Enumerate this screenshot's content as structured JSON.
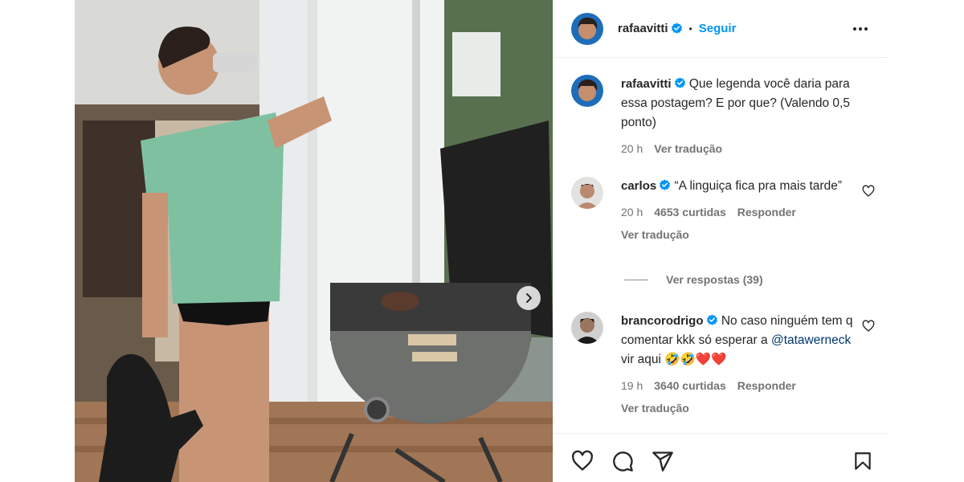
{
  "post": {
    "username": "rafaavitti",
    "follow_label": "Seguir",
    "separator": "•"
  },
  "caption": {
    "username": "rafaavitti",
    "text": "Que legenda você daria para essa postagem? E por que? (Valendo 0,5 ponto)",
    "time": "20 h",
    "translate_label": "Ver tradução"
  },
  "comments": [
    {
      "username": "carlos",
      "text": "“A linguiça fica pra mais tarde”",
      "time": "20 h",
      "likes": "4653 curtidas",
      "reply_label": "Responder",
      "translate_label": "Ver tradução"
    },
    {
      "username": "brancorodrigo",
      "text": "No caso ninguém tem q comentar kkk só esperar a",
      "mention": "@tatawerneck",
      "text_after": "vir aqui 🤣🤣❤️❤️",
      "time": "19 h",
      "likes": "3640 curtidas",
      "reply_label": "Responder",
      "translate_label": "Ver tradução"
    }
  ],
  "replies_label": "Ver respostas (39)",
  "icons": {
    "more": "more-options-icon",
    "like": "heart-icon",
    "comment": "comment-icon",
    "share": "share-icon",
    "save": "bookmark-icon",
    "next": "chevron-right-icon",
    "verified": "verified-badge-icon"
  },
  "colors": {
    "accent": "#0095f6",
    "verified": "#0095f6",
    "text": "#262626",
    "muted": "#737373",
    "mention": "#00376b"
  }
}
